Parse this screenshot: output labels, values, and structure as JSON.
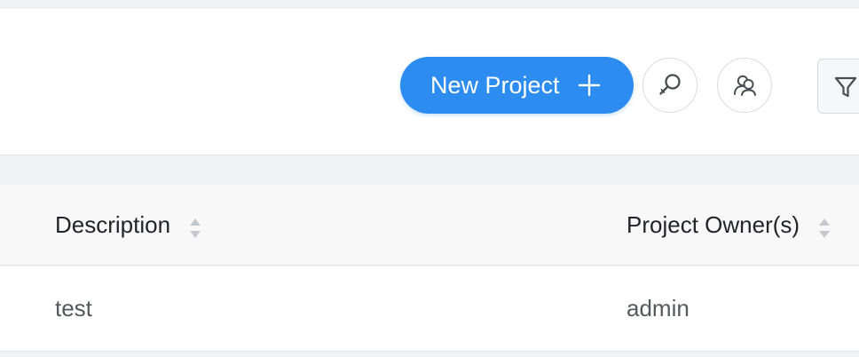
{
  "toolbar": {
    "new_project_label": "New Project",
    "new_project_icon": "plus-icon",
    "search_icon": "search-icon",
    "user_icon": "users-icon",
    "filter_icon": "filter-icon",
    "accent_color": "#2d8cf0"
  },
  "table": {
    "columns": [
      {
        "label": "Description",
        "sortable": true
      },
      {
        "label": "Project Owner(s)",
        "sortable": true
      }
    ],
    "rows": [
      {
        "description": "test",
        "owners": "admin"
      }
    ]
  }
}
